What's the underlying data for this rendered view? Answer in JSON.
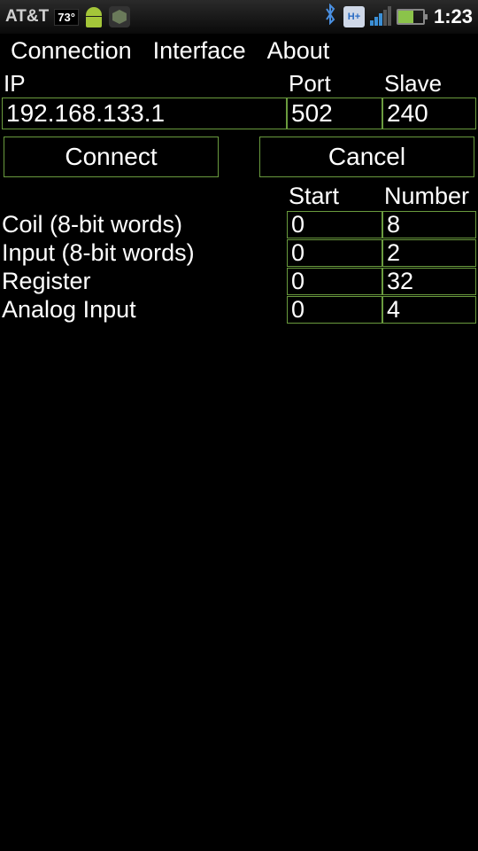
{
  "status": {
    "carrier": "AT&T",
    "temp": "73°",
    "network_type": "H+",
    "time": "1:23"
  },
  "tabs": {
    "connection": "Connection",
    "interface": "Interface",
    "about": "About"
  },
  "labels": {
    "ip": "IP",
    "port": "Port",
    "slave": "Slave",
    "start": "Start",
    "number": "Number"
  },
  "fields": {
    "ip": "192.168.133.1",
    "port": "502",
    "slave": "240"
  },
  "buttons": {
    "connect": "Connect",
    "cancel": "Cancel"
  },
  "rows": {
    "coil": {
      "label": "Coil (8-bit words)",
      "start": "0",
      "number": "8"
    },
    "input": {
      "label": "Input (8-bit words)",
      "start": "0",
      "number": "2"
    },
    "register": {
      "label": "Register",
      "start": "0",
      "number": "32"
    },
    "analog": {
      "label": "Analog Input",
      "start": "0",
      "number": "4"
    }
  }
}
